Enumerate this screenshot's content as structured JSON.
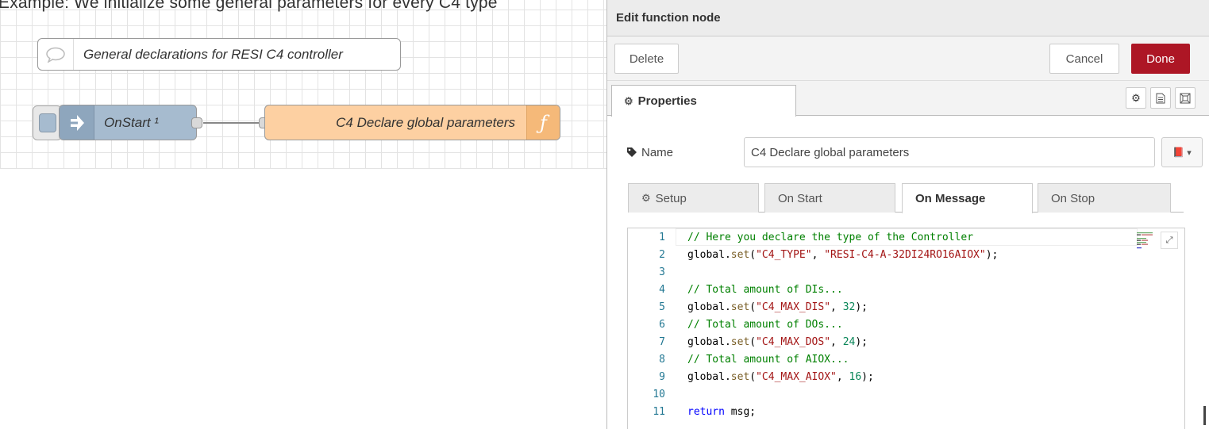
{
  "canvas": {
    "caption": "Example: We initialize some general parameters for every C4 type",
    "comment_node": {
      "label": "General declarations for RESI C4 controller"
    },
    "inject_node": {
      "label": "OnStart ¹"
    },
    "function_node": {
      "label": "C4 Declare global parameters",
      "icon": "ƒ"
    },
    "colors": {
      "inject": "#a6bbcf",
      "function": "#fdd0a2"
    }
  },
  "editor": {
    "title": "Edit function node",
    "toolbar": {
      "delete_label": "Delete",
      "cancel_label": "Cancel",
      "done_label": "Done"
    },
    "tabs": {
      "properties_label": "Properties"
    },
    "name_field": {
      "label": "Name",
      "value": "C4  Declare global parameters"
    },
    "subtabs": [
      {
        "label": "Setup",
        "icon": "gear-icon"
      },
      {
        "label": "On Start"
      },
      {
        "label": "On Message"
      },
      {
        "label": "On Stop"
      }
    ],
    "active_subtab": "On Message",
    "code": {
      "line_numbers": [
        "1",
        "2",
        "3",
        "4",
        "5",
        "6",
        "7",
        "8",
        "9",
        "10",
        "11"
      ],
      "lines": [
        [
          {
            "t": "comment",
            "v": "// Here you declare the type of the Controller"
          }
        ],
        [
          {
            "t": "ident",
            "v": "global."
          },
          {
            "t": "method",
            "v": "set"
          },
          {
            "t": "ident",
            "v": "("
          },
          {
            "t": "string",
            "v": "\"C4_TYPE\""
          },
          {
            "t": "ident",
            "v": ", "
          },
          {
            "t": "string",
            "v": "\"RESI-C4-A-32DI24RO16AIOX\""
          },
          {
            "t": "ident",
            "v": ");"
          }
        ],
        [],
        [
          {
            "t": "comment",
            "v": "// Total amount of DIs..."
          }
        ],
        [
          {
            "t": "ident",
            "v": "global."
          },
          {
            "t": "method",
            "v": "set"
          },
          {
            "t": "ident",
            "v": "("
          },
          {
            "t": "string",
            "v": "\"C4_MAX_DIS\""
          },
          {
            "t": "ident",
            "v": ", "
          },
          {
            "t": "number",
            "v": "32"
          },
          {
            "t": "ident",
            "v": ");"
          }
        ],
        [
          {
            "t": "comment",
            "v": "// Total amount of DOs..."
          }
        ],
        [
          {
            "t": "ident",
            "v": "global."
          },
          {
            "t": "method",
            "v": "set"
          },
          {
            "t": "ident",
            "v": "("
          },
          {
            "t": "string",
            "v": "\"C4_MAX_DOS\""
          },
          {
            "t": "ident",
            "v": ", "
          },
          {
            "t": "number",
            "v": "24"
          },
          {
            "t": "ident",
            "v": ");"
          }
        ],
        [
          {
            "t": "comment",
            "v": "// Total amount of AIOX..."
          }
        ],
        [
          {
            "t": "ident",
            "v": "global."
          },
          {
            "t": "method",
            "v": "set"
          },
          {
            "t": "ident",
            "v": "("
          },
          {
            "t": "string",
            "v": "\"C4_MAX_AIOX\""
          },
          {
            "t": "ident",
            "v": ", "
          },
          {
            "t": "number",
            "v": "16"
          },
          {
            "t": "ident",
            "v": ");"
          }
        ],
        [],
        [
          {
            "t": "keyword",
            "v": "return"
          },
          {
            "t": "ident",
            "v": " msg;"
          }
        ]
      ]
    },
    "colors": {
      "done_button": "#ad1625"
    }
  }
}
